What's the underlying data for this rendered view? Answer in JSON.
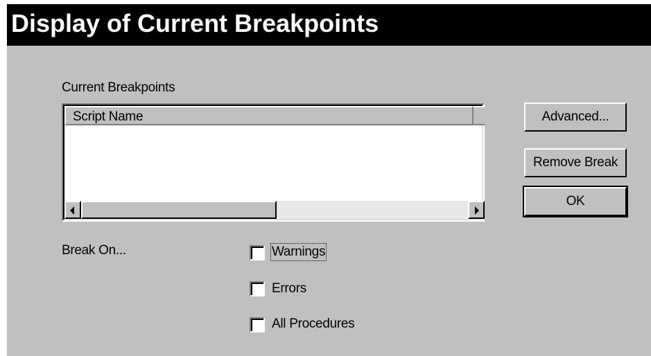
{
  "dialog": {
    "title": "Display of Current Breakpoints",
    "breakpoints_label": "Current Breakpoints",
    "list_column_header": "Script Name",
    "break_on_label": "Break On..."
  },
  "buttons": {
    "advanced": "Advanced...",
    "remove_break": "Remove Break",
    "ok": "OK"
  },
  "checkboxes": {
    "warnings": {
      "label": "Warnings",
      "checked": false
    },
    "errors": {
      "label": "Errors",
      "checked": false
    },
    "all_procedures": {
      "label": "All Procedures",
      "checked": false
    }
  },
  "colors": {
    "face": "#c0c0c0",
    "titlebar": "#000000",
    "title_text": "#ffffff"
  },
  "icons": {
    "scroll_left": "left-arrow-icon",
    "scroll_right": "right-arrow-icon"
  }
}
